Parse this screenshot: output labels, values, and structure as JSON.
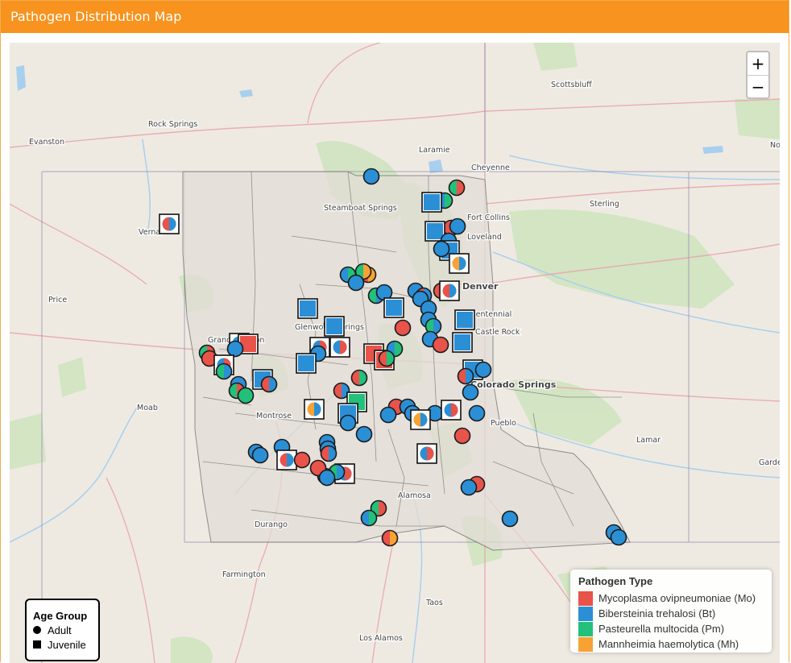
{
  "header": {
    "title": "Pathogen Distribution Map"
  },
  "zoom": {
    "in_label": "+",
    "out_label": "−"
  },
  "colors": {
    "mo": "#e8534a",
    "bt": "#2b8fd6",
    "pm": "#22c07a",
    "mh": "#f7a233",
    "header": "#f7931e"
  },
  "cities": [
    "Rock Springs",
    "Evanston",
    "Laramie",
    "Cheyenne",
    "Scottsbluff",
    "Sterling",
    "Steamboat Springs",
    "Vernal",
    "Price",
    "Moab",
    "Denver",
    "Centennial",
    "Castle Rock",
    "Colorado Springs",
    "Pueblo",
    "Montrose",
    "Durango",
    "Farmington",
    "Alamosa",
    "Taos",
    "Los Alamos",
    "Lamar",
    "Garden City",
    "Fort Collins",
    "Loveland",
    "Grand Junction",
    "Glenwood Springs",
    "North Platte"
  ],
  "legend_type": {
    "title": "Pathogen Type",
    "items": [
      {
        "label": "Mycoplasma ovipneumoniae (Mo)",
        "color": "#e8534a"
      },
      {
        "label": "Bibersteinia trehalosi (Bt)",
        "color": "#2b8fd6"
      },
      {
        "label": "Pasteurella multocida (Pm)",
        "color": "#22c07a"
      },
      {
        "label": "Mannheimia haemolytica (Mh)",
        "color": "#f7a233"
      }
    ]
  },
  "legend_age": {
    "title": "Age Group",
    "adult": "Adult",
    "juvenile": "Juvenile"
  }
}
